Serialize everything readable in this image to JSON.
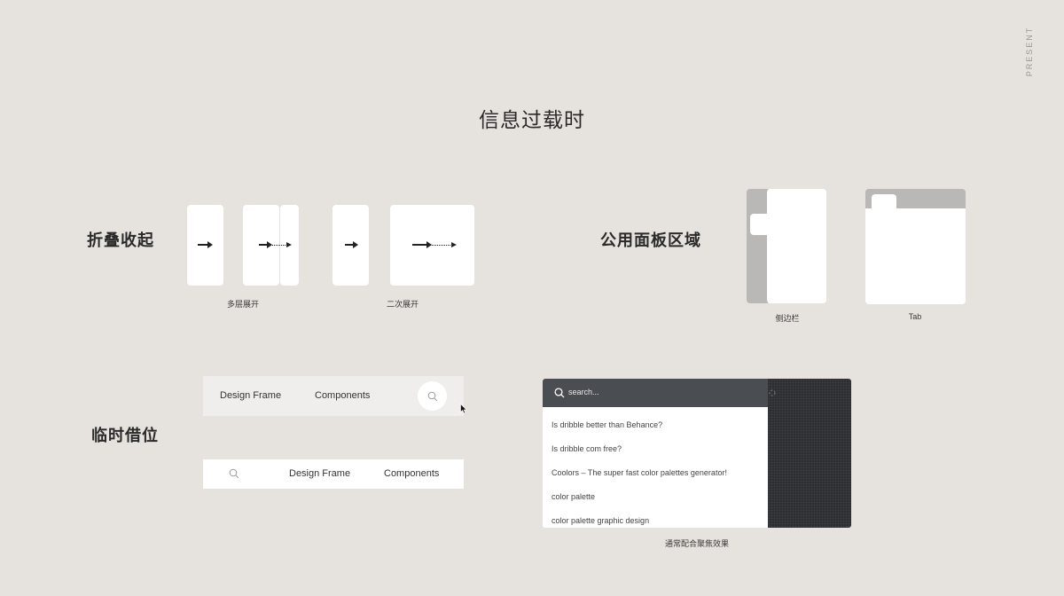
{
  "corner_label": "PRESENT",
  "title": "信息过载时",
  "sections": {
    "fold": {
      "title": "折叠收起",
      "captions": [
        "多层展开",
        "二次展开"
      ]
    },
    "panel": {
      "title": "公用面板区域",
      "captions": [
        "侧边栏",
        "Tab"
      ]
    },
    "borrow": {
      "title": "临时借位"
    }
  },
  "bar_top": {
    "items": [
      "Design Frame",
      "Components"
    ],
    "icon": "search-icon"
  },
  "bar_bottom": {
    "items": [
      "Design Frame",
      "Components"
    ],
    "icon": "search-icon"
  },
  "search_panel": {
    "placeholder": "search...",
    "results": [
      "Is dribble better than Behance?",
      "Is dribble com free?",
      "Coolors – The super fast color palettes generator!",
      "color palette",
      "color palette graphic design"
    ],
    "caption": "通常配合聚焦效果"
  },
  "colors": {
    "background": "#e6e2dd",
    "card": "#ffffff",
    "gray_panel": "#b9b8b6",
    "dark_panel": "#2c2e32",
    "search_bar": "#4a4d52"
  }
}
